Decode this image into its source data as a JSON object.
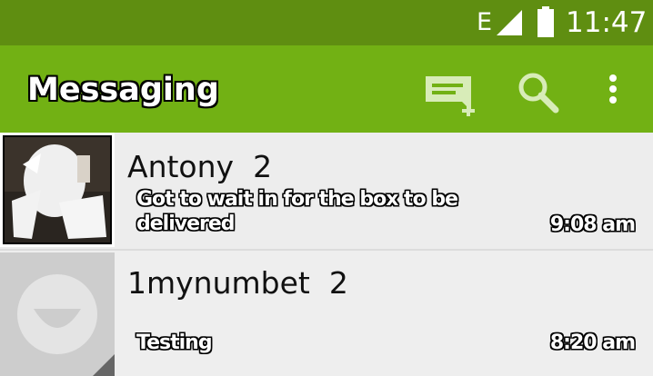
{
  "status_bar": {
    "network_type": "E",
    "clock": "11:47",
    "icons": [
      "signal-icon",
      "battery-icon"
    ]
  },
  "action_bar": {
    "title": "Messaging",
    "actions": [
      "new-message-icon",
      "search-icon",
      "overflow-menu-icon"
    ]
  },
  "conversations": [
    {
      "name": "Antony",
      "count": "2",
      "snippet": "Got to wait in for the box to be delivered",
      "time": "9:08 am",
      "avatar": "contact-photo"
    },
    {
      "name": "1mynumbet",
      "count": "2",
      "snippet": "Testing",
      "time": "8:20 am",
      "avatar": "default-contact-avatar"
    }
  ],
  "colors": {
    "status_bar": "#5f8e11",
    "action_bar": "#72b114",
    "list_background": "#eeeeee"
  }
}
